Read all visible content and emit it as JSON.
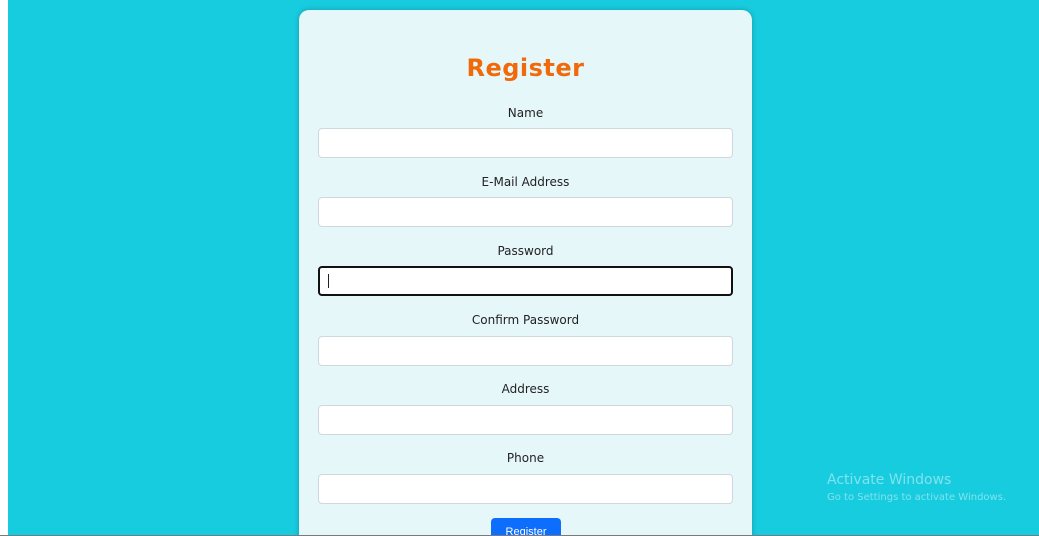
{
  "form": {
    "title": "Register",
    "fields": [
      {
        "label": "Name",
        "value": ""
      },
      {
        "label": "E-Mail Address",
        "value": ""
      },
      {
        "label": "Password",
        "value": ""
      },
      {
        "label": "Confirm Password",
        "value": ""
      },
      {
        "label": "Address",
        "value": ""
      },
      {
        "label": "Phone",
        "value": ""
      }
    ],
    "submit_label": "Register"
  },
  "watermark": {
    "title": "Activate Windows",
    "subtitle": "Go to Settings to activate Windows."
  },
  "colors": {
    "background": "#18cce0",
    "card": "#e6f7fa",
    "title": "#f06a0a",
    "button": "#0d6efd"
  }
}
